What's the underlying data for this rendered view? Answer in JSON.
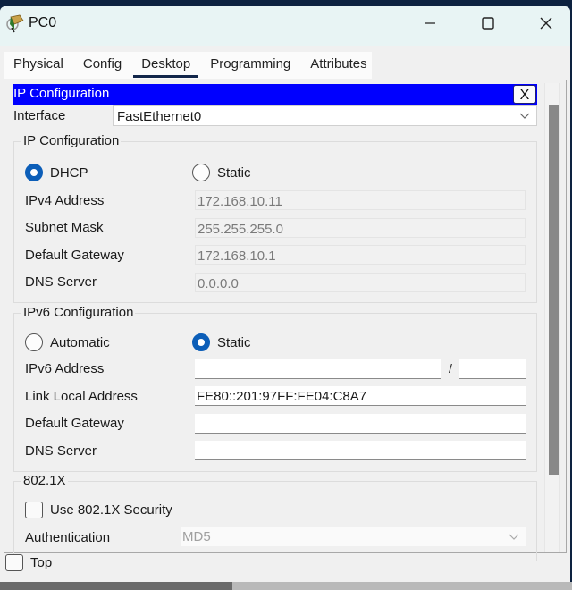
{
  "window": {
    "title": "PC0",
    "controls": {
      "minimize": "minimize",
      "maximize": "maximize",
      "close": "close"
    }
  },
  "tabs": [
    {
      "label": "Physical",
      "active": false
    },
    {
      "label": "Config",
      "active": false
    },
    {
      "label": "Desktop",
      "active": true
    },
    {
      "label": "Programming",
      "active": false
    },
    {
      "label": "Attributes",
      "active": false
    }
  ],
  "panel": {
    "title": "IP Configuration",
    "close_label": "X",
    "header_color": "#0000ff",
    "interface_label": "Interface",
    "interface_value": "FastEthernet0"
  },
  "ipv4": {
    "group_title": "IP Configuration",
    "mode_options": [
      {
        "label": "DHCP",
        "selected": true
      },
      {
        "label": "Static",
        "selected": false
      }
    ],
    "fields": [
      {
        "label": "IPv4 Address",
        "value": "172.168.10.11"
      },
      {
        "label": "Subnet Mask",
        "value": "255.255.255.0"
      },
      {
        "label": "Default Gateway",
        "value": "172.168.10.1"
      },
      {
        "label": "DNS Server",
        "value": "0.0.0.0"
      }
    ]
  },
  "ipv6": {
    "group_title": "IPv6 Configuration",
    "mode_options": [
      {
        "label": "Automatic",
        "selected": false
      },
      {
        "label": "Static",
        "selected": true
      }
    ],
    "address_label": "IPv6 Address",
    "address_value": "",
    "prefix_separator": "/",
    "prefix_value": "",
    "link_local_label": "Link Local Address",
    "link_local_value": "FE80::201:97FF:FE04:C8A7",
    "gateway_label": "Default Gateway",
    "gateway_value": "",
    "dns_label": "DNS Server",
    "dns_value": ""
  },
  "dot1x": {
    "group_title": "802.1X",
    "use_security_label": "Use 802.1X Security",
    "use_security_checked": false,
    "auth_label": "Authentication",
    "auth_value": "MD5"
  },
  "footer": {
    "top_label": "Top",
    "top_checked": false
  },
  "accent_color": "#0c5eb8"
}
